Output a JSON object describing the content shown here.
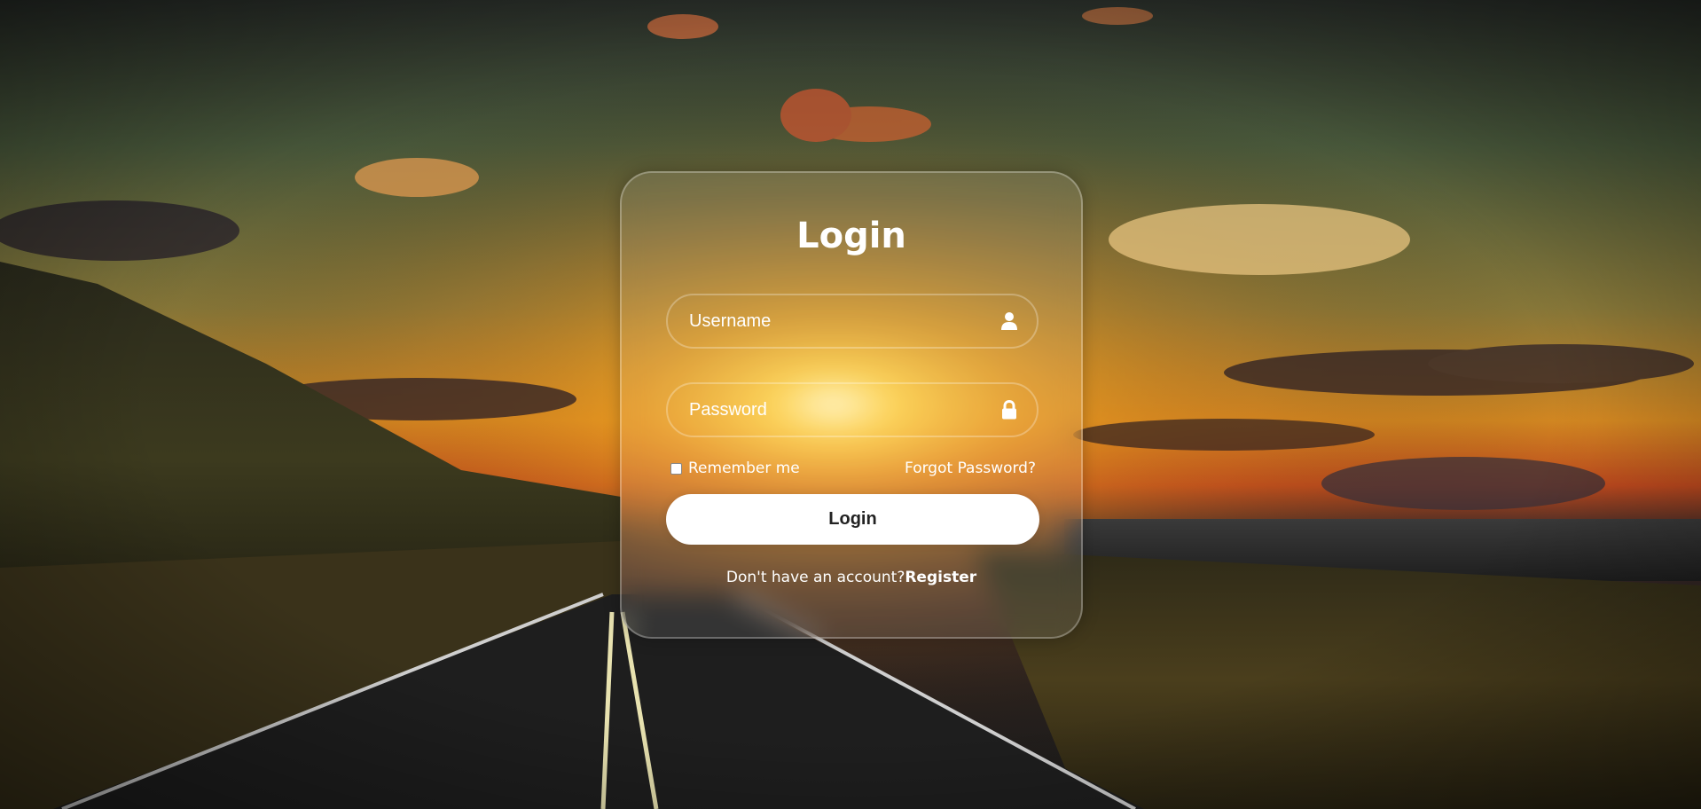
{
  "login_form": {
    "title": "Login",
    "username": {
      "placeholder": "Username",
      "value": "",
      "icon": "user-icon"
    },
    "password": {
      "placeholder": "Password",
      "value": "",
      "icon": "lock-icon"
    },
    "remember_me_label": "Remember me",
    "remember_me_checked": false,
    "forgot_password_label": "Forgot Password?",
    "submit_label": "Login",
    "register_prompt": "Don't have an account?",
    "register_link_label": "Register"
  },
  "background": {
    "description_icon": "sunset-road-background"
  },
  "colors": {
    "text": "#ffffff",
    "button_bg": "#ffffff",
    "button_text": "#222222",
    "card_border": "rgba(255,255,255,0.28)"
  }
}
